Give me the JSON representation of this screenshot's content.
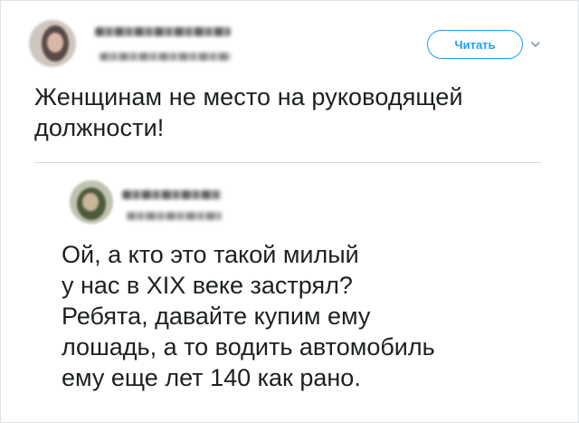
{
  "tweet": {
    "follow_label": "Читать",
    "chevron_icon": "chevron-down-icon",
    "text": "Женщинам не место на руководящей должности!"
  },
  "reply": {
    "text": "Ой, а кто это такой милый\nу нас в XIX веке застрял?\nРебята, давайте купим ему\nлошадь, а то водить автомобиль\nему еще лет 140 как рано."
  },
  "colors": {
    "accent": "#1da1f2",
    "text": "#1c2022",
    "muted": "#8899a6"
  }
}
